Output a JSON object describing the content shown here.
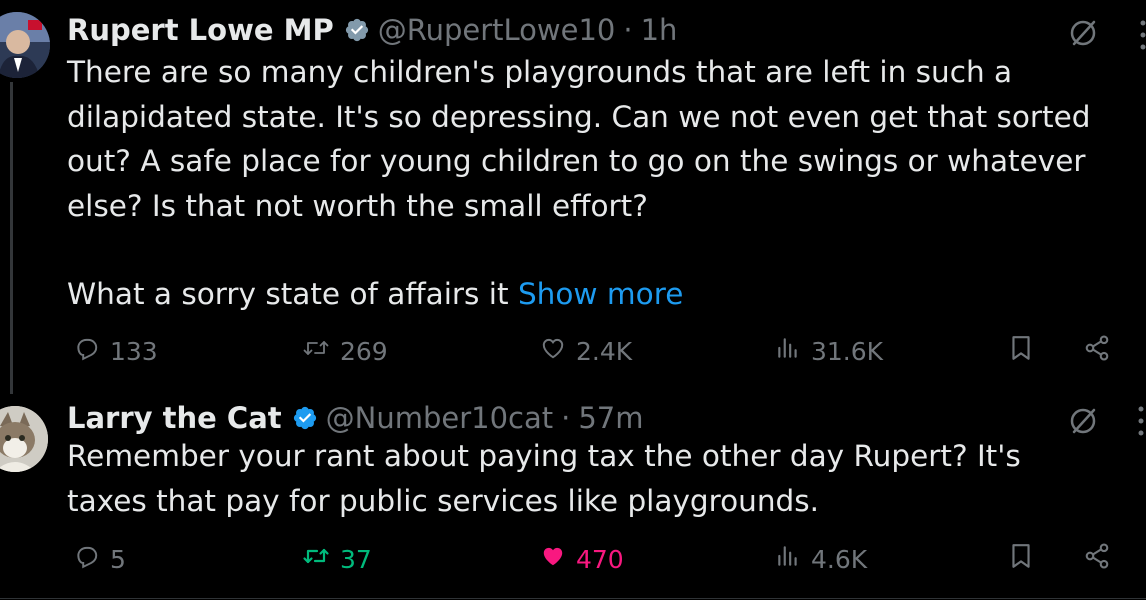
{
  "tweets": [
    {
      "name": "Rupert Lowe MP",
      "handle": "@RupertLowe10",
      "separator": "·",
      "time": "1h",
      "text_lines": [
        "There are so many children's playgrounds that are left in such a",
        "dilapidated state. It's so depressing. Can we not even get that sorted",
        "out? A safe place for young children to go on the swings or whatever",
        "else? Is that not worth the small effort?"
      ],
      "text_after_gap": "What a sorry state of affairs it ",
      "show_more": "Show more",
      "replies": "133",
      "reposts": "269",
      "likes": "2.4K",
      "views": "31.6K",
      "liked": false
    },
    {
      "name": "Larry the Cat",
      "handle": "@Number10cat",
      "separator": "·",
      "time": "57m",
      "text_lines": [
        "Remember your rant about paying tax the other day Rupert? It's",
        "taxes that pay for public services like playgrounds."
      ],
      "replies": "5",
      "reposts": "37",
      "likes": "470",
      "views": "4.6K",
      "liked": true,
      "reposted": true
    }
  ],
  "colors": {
    "background": "#000000",
    "text": "#e7e9ea",
    "muted": "#71767b",
    "link": "#1d9bf0",
    "verified": "#1d9bf0",
    "repost_active": "#00ba7c",
    "like_active": "#f91880"
  },
  "icons": {
    "verified": "verified-badge-icon",
    "grok": "grok-icon",
    "more": "more-options-icon",
    "reply": "reply-icon",
    "repost": "repost-icon",
    "like": "heart-icon",
    "views": "views-chart-icon",
    "bookmark": "bookmark-icon",
    "share": "share-icon"
  }
}
